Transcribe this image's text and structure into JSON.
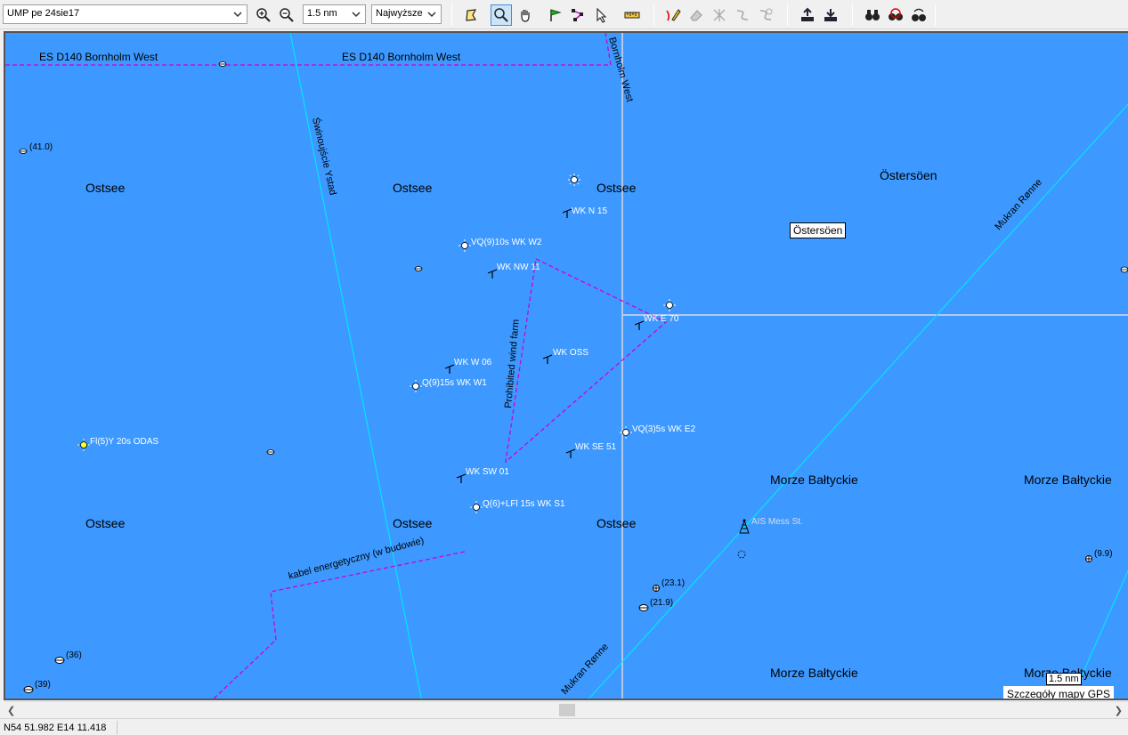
{
  "toolbar": {
    "map_select": "UMP pe 24sie17",
    "scale_select": "1.5 nm",
    "detail_select": "Najwyższe",
    "buttons": [
      {
        "icon": "zoom-in-icon"
      },
      {
        "icon": "zoom-out-icon"
      }
    ]
  },
  "map": {
    "background_color": "#3d99ff",
    "zone_labels": [
      "ES D140 Bornholm West",
      "ES D140 Bornholm West",
      "Bornholm West"
    ],
    "sea_labels": {
      "ostsee": "Ostsee",
      "ostersoen": "Östersöen",
      "morze": "Morze Bałtyckie"
    },
    "route_labels": {
      "swinoujscie": "Świnoujście Ystad",
      "mukran_top": "Mukran Rønne",
      "mukran_bottom": "Mukran Rønne",
      "wind_farm": "Prohibited wind farm",
      "cable": "kabel energetyczny (w budowie)"
    },
    "depths": {
      "d41": "(41.0)",
      "d36": "(36)",
      "d39": "(39)",
      "d23": "(23.1)",
      "d21": "(21.9)",
      "d9": "(9.9)"
    },
    "turbines": {
      "wk_n15": "WK N 15",
      "wk_nw11": "WK NW 11",
      "wk_e70": "WK E 70",
      "wk_w06": "WK W 06",
      "wk_oss": "WK OSS",
      "wk_se51": "WK SE 51",
      "wk_sw01": "WK SW 01"
    },
    "lights": {
      "vq9_w2": "VQ(9)10s WK W2",
      "q9_w1": "Q(9)15s WK W1",
      "fly_odas": "Fl(5)Y 20s ODAS",
      "vq3_e2": "VQ(3)5s WK E2",
      "q6_s1": "Q(6)+LFl 15s WK S1"
    },
    "ais_station": "AIS Mess St.",
    "info_box": "Östersöen",
    "scale_label": "1.5 nm",
    "detail_label": "Szczegóły mapy GPS"
  },
  "status": {
    "coordinates": "N54 51.982 E14 11.418"
  }
}
